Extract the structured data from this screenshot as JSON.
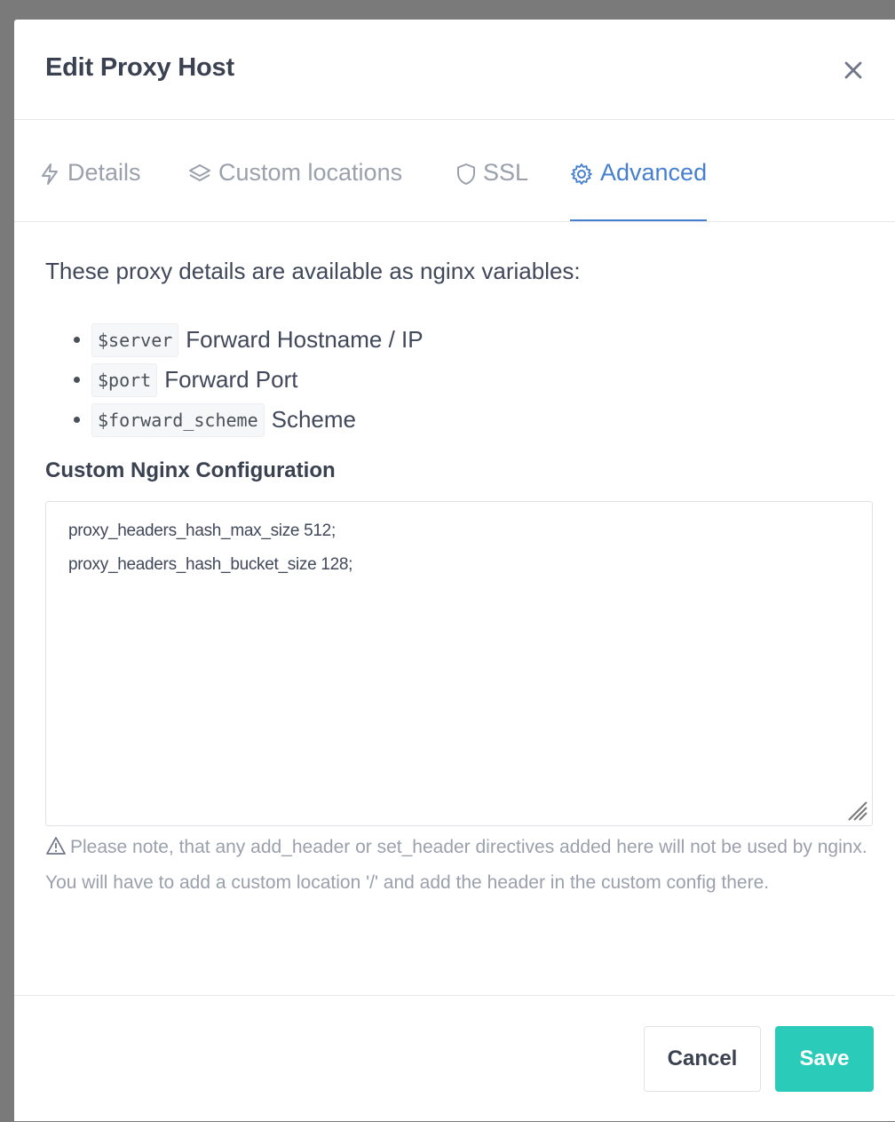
{
  "modal": {
    "title": "Edit Proxy Host",
    "close_icon": "close-icon"
  },
  "tabs": [
    {
      "label": "Details",
      "icon": "lightning-icon",
      "active": false
    },
    {
      "label": "Custom locations",
      "icon": "layers-icon",
      "active": false
    },
    {
      "label": "SSL",
      "icon": "shield-icon",
      "active": false
    },
    {
      "label": "Advanced",
      "icon": "gear-icon",
      "active": true
    }
  ],
  "advanced": {
    "intro": "These proxy details are available as nginx variables:",
    "variables": [
      {
        "code": "$server",
        "description": "Forward Hostname / IP"
      },
      {
        "code": "$port",
        "description": "Forward Port"
      },
      {
        "code": "$forward_scheme",
        "description": "Scheme"
      }
    ],
    "config_label": "Custom Nginx Configuration",
    "config_lines": [
      "proxy_headers_hash_max_size 512;",
      "proxy_headers_hash_bucket_size 128;"
    ],
    "note": "Please note, that any add_header or set_header directives added here will not be used by nginx. You will have to add a custom location '/' and add the header in the custom config there."
  },
  "footer": {
    "cancel_label": "Cancel",
    "save_label": "Save"
  },
  "colors": {
    "accent": "#467fcf",
    "save": "#2bcbba",
    "muted": "#9aa0ac"
  }
}
